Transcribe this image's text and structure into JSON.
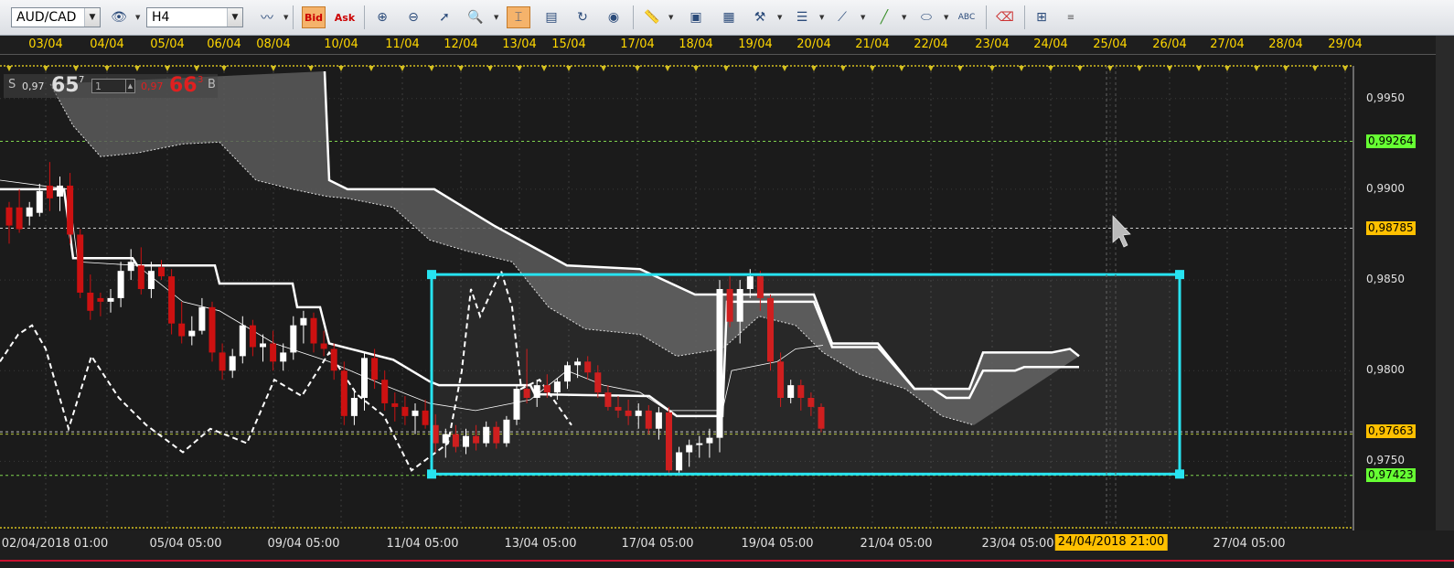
{
  "toolbar": {
    "symbol": "AUD/CAD",
    "timeframe": "H4",
    "bid_label": "Bid",
    "ask_label": "Ask",
    "icons": [
      "eye-settings-icon",
      "indicator-icon",
      "chart-type-icon",
      "crosshair-icon",
      "zoom-in-icon",
      "zoom-out-icon",
      "cursor-icon",
      "zoom-icon",
      "grid-icon",
      "save-icon",
      "refresh-icon",
      "globe-icon",
      "ruler-icon",
      "image-icon",
      "template-icon",
      "tools-icon",
      "lines-icon",
      "fibonacci-icon",
      "pencil-icon",
      "ellipse-icon",
      "text-icon",
      "eraser-icon",
      "network-icon",
      "menu-icon"
    ]
  },
  "quote": {
    "sell_label": "S",
    "sell_prefix": "0,97",
    "sell_big": "65",
    "sell_sup": "7",
    "lot": "1",
    "buy_prefix": "0,97",
    "buy_big": "66",
    "buy_sup": "3",
    "buy_label": "B"
  },
  "date_axis": [
    "03/04",
    "04/04",
    "05/04",
    "06/04",
    "08/04",
    "10/04",
    "11/04",
    "12/04",
    "13/04",
    "15/04",
    "17/04",
    "18/04",
    "19/04",
    "20/04",
    "21/04",
    "22/04",
    "23/04",
    "24/04",
    "25/04",
    "26/04",
    "27/04",
    "28/04",
    "29/04"
  ],
  "price_axis": {
    "labels": [
      "0,9950",
      "0,9900",
      "0,9850",
      "0,9800",
      "0,9750"
    ],
    "markers": [
      {
        "value": "0,99264",
        "color": "#66ff33"
      },
      {
        "value": "0,98785",
        "color": "#ffc000"
      },
      {
        "value": "0,97663",
        "color": "#ffc000"
      },
      {
        "value": "0,97423",
        "color": "#66ff33"
      }
    ]
  },
  "time_axis": [
    "02/04/2018 01:00",
    "05/04 05:00",
    "09/04 05:00",
    "11/04 05:00",
    "13/04 05:00",
    "17/04 05:00",
    "19/04 05:00",
    "21/04 05:00",
    "23/04 05:00",
    "27/04 05:00"
  ],
  "cursor_time": "24/04/2018 21:00",
  "colors": {
    "bull": "#ffffff",
    "bear": "#cc1111",
    "rect": "#27e3f0",
    "cloud": "#5a5a5a"
  },
  "chart_data": {
    "type": "candlestick",
    "symbol": "AUD/CAD",
    "timeframe": "H4",
    "ylim": [
      0.9725,
      0.9965
    ],
    "candles": [
      {
        "o": 0.989,
        "h": 0.9893,
        "l": 0.987,
        "c": 0.988
      },
      {
        "o": 0.989,
        "h": 0.99,
        "l": 0.9876,
        "c": 0.9878
      },
      {
        "o": 0.9885,
        "h": 0.9893,
        "l": 0.988,
        "c": 0.989
      },
      {
        "o": 0.9887,
        "h": 0.9903,
        "l": 0.9885,
        "c": 0.9899
      },
      {
        "o": 0.9902,
        "h": 0.9915,
        "l": 0.9888,
        "c": 0.9895
      },
      {
        "o": 0.9896,
        "h": 0.9907,
        "l": 0.9888,
        "c": 0.9902
      },
      {
        "o": 0.9902,
        "h": 0.9909,
        "l": 0.987,
        "c": 0.9875
      },
      {
        "o": 0.9875,
        "h": 0.9878,
        "l": 0.984,
        "c": 0.9843
      },
      {
        "o": 0.9843,
        "h": 0.9853,
        "l": 0.9828,
        "c": 0.9833
      },
      {
        "o": 0.984,
        "h": 0.9843,
        "l": 0.983,
        "c": 0.9838
      },
      {
        "o": 0.9838,
        "h": 0.9845,
        "l": 0.9832,
        "c": 0.984
      },
      {
        "o": 0.984,
        "h": 0.986,
        "l": 0.9835,
        "c": 0.9855
      },
      {
        "o": 0.9855,
        "h": 0.9867,
        "l": 0.985,
        "c": 0.986
      },
      {
        "o": 0.9858,
        "h": 0.9868,
        "l": 0.9842,
        "c": 0.9845
      },
      {
        "o": 0.9845,
        "h": 0.986,
        "l": 0.984,
        "c": 0.9855
      },
      {
        "o": 0.9857,
        "h": 0.9861,
        "l": 0.985,
        "c": 0.9852
      },
      {
        "o": 0.9852,
        "h": 0.9856,
        "l": 0.982,
        "c": 0.9826
      },
      {
        "o": 0.9826,
        "h": 0.9838,
        "l": 0.9815,
        "c": 0.9819
      },
      {
        "o": 0.9819,
        "h": 0.983,
        "l": 0.9814,
        "c": 0.9822
      },
      {
        "o": 0.9822,
        "h": 0.984,
        "l": 0.982,
        "c": 0.9835
      },
      {
        "o": 0.9835,
        "h": 0.9838,
        "l": 0.9805,
        "c": 0.981
      },
      {
        "o": 0.981,
        "h": 0.9815,
        "l": 0.9795,
        "c": 0.98
      },
      {
        "o": 0.98,
        "h": 0.9812,
        "l": 0.9796,
        "c": 0.9808
      },
      {
        "o": 0.9808,
        "h": 0.983,
        "l": 0.9804,
        "c": 0.9825
      },
      {
        "o": 0.9825,
        "h": 0.9828,
        "l": 0.9808,
        "c": 0.9813
      },
      {
        "o": 0.9813,
        "h": 0.982,
        "l": 0.9805,
        "c": 0.9815
      },
      {
        "o": 0.9815,
        "h": 0.9822,
        "l": 0.98,
        "c": 0.9805
      },
      {
        "o": 0.9805,
        "h": 0.9815,
        "l": 0.98,
        "c": 0.981
      },
      {
        "o": 0.981,
        "h": 0.983,
        "l": 0.9806,
        "c": 0.9825
      },
      {
        "o": 0.9825,
        "h": 0.9833,
        "l": 0.9815,
        "c": 0.9829
      },
      {
        "o": 0.9829,
        "h": 0.9832,
        "l": 0.981,
        "c": 0.9815
      },
      {
        "o": 0.9815,
        "h": 0.9822,
        "l": 0.9808,
        "c": 0.9812
      },
      {
        "o": 0.9812,
        "h": 0.9815,
        "l": 0.9795,
        "c": 0.98
      },
      {
        "o": 0.98,
        "h": 0.9805,
        "l": 0.977,
        "c": 0.9775
      },
      {
        "o": 0.9775,
        "h": 0.979,
        "l": 0.977,
        "c": 0.9785
      },
      {
        "o": 0.9785,
        "h": 0.981,
        "l": 0.9778,
        "c": 0.9807
      },
      {
        "o": 0.9807,
        "h": 0.9812,
        "l": 0.979,
        "c": 0.9795
      },
      {
        "o": 0.9795,
        "h": 0.98,
        "l": 0.9778,
        "c": 0.9782
      },
      {
        "o": 0.9782,
        "h": 0.9788,
        "l": 0.9772,
        "c": 0.978
      },
      {
        "o": 0.978,
        "h": 0.9786,
        "l": 0.977,
        "c": 0.9775
      },
      {
        "o": 0.9775,
        "h": 0.9782,
        "l": 0.9765,
        "c": 0.9778
      },
      {
        "o": 0.9778,
        "h": 0.9784,
        "l": 0.9768,
        "c": 0.977
      },
      {
        "o": 0.977,
        "h": 0.9776,
        "l": 0.9755,
        "c": 0.976
      },
      {
        "o": 0.976,
        "h": 0.9768,
        "l": 0.9752,
        "c": 0.9765
      },
      {
        "o": 0.9765,
        "h": 0.977,
        "l": 0.9755,
        "c": 0.9758
      },
      {
        "o": 0.9758,
        "h": 0.9768,
        "l": 0.9754,
        "c": 0.9764
      },
      {
        "o": 0.9764,
        "h": 0.977,
        "l": 0.9756,
        "c": 0.976
      },
      {
        "o": 0.976,
        "h": 0.9772,
        "l": 0.9758,
        "c": 0.9769
      },
      {
        "o": 0.9769,
        "h": 0.9772,
        "l": 0.9757,
        "c": 0.976
      },
      {
        "o": 0.976,
        "h": 0.9775,
        "l": 0.9758,
        "c": 0.9773
      },
      {
        "o": 0.9773,
        "h": 0.9792,
        "l": 0.977,
        "c": 0.979
      },
      {
        "o": 0.979,
        "h": 0.9812,
        "l": 0.9782,
        "c": 0.9785
      },
      {
        "o": 0.9785,
        "h": 0.9795,
        "l": 0.978,
        "c": 0.9792
      },
      {
        "o": 0.9792,
        "h": 0.9798,
        "l": 0.9785,
        "c": 0.9788
      },
      {
        "o": 0.9788,
        "h": 0.9796,
        "l": 0.9784,
        "c": 0.9794
      },
      {
        "o": 0.9794,
        "h": 0.9805,
        "l": 0.979,
        "c": 0.9803
      },
      {
        "o": 0.9803,
        "h": 0.9807,
        "l": 0.9796,
        "c": 0.9805
      },
      {
        "o": 0.9805,
        "h": 0.9808,
        "l": 0.9795,
        "c": 0.9799
      },
      {
        "o": 0.9799,
        "h": 0.9803,
        "l": 0.9785,
        "c": 0.9788
      },
      {
        "o": 0.9788,
        "h": 0.9792,
        "l": 0.9778,
        "c": 0.978
      },
      {
        "o": 0.978,
        "h": 0.9786,
        "l": 0.9774,
        "c": 0.9778
      },
      {
        "o": 0.9778,
        "h": 0.9784,
        "l": 0.977,
        "c": 0.9775
      },
      {
        "o": 0.9775,
        "h": 0.9782,
        "l": 0.9768,
        "c": 0.9778
      },
      {
        "o": 0.9778,
        "h": 0.9781,
        "l": 0.9765,
        "c": 0.9768
      },
      {
        "o": 0.9768,
        "h": 0.978,
        "l": 0.9762,
        "c": 0.9777
      },
      {
        "o": 0.9777,
        "h": 0.978,
        "l": 0.9742,
        "c": 0.9745
      },
      {
        "o": 0.9745,
        "h": 0.9758,
        "l": 0.9742,
        "c": 0.9755
      },
      {
        "o": 0.9755,
        "h": 0.9762,
        "l": 0.9747,
        "c": 0.9759
      },
      {
        "o": 0.9759,
        "h": 0.9764,
        "l": 0.9752,
        "c": 0.976
      },
      {
        "o": 0.976,
        "h": 0.9768,
        "l": 0.9752,
        "c": 0.9763
      },
      {
        "o": 0.9763,
        "h": 0.985,
        "l": 0.9755,
        "c": 0.9845
      },
      {
        "o": 0.9845,
        "h": 0.9852,
        "l": 0.9824,
        "c": 0.9827
      },
      {
        "o": 0.9827,
        "h": 0.985,
        "l": 0.9815,
        "c": 0.9845
      },
      {
        "o": 0.9845,
        "h": 0.9856,
        "l": 0.984,
        "c": 0.9852
      },
      {
        "o": 0.9852,
        "h": 0.9855,
        "l": 0.9833,
        "c": 0.984
      },
      {
        "o": 0.984,
        "h": 0.9842,
        "l": 0.98,
        "c": 0.9805
      },
      {
        "o": 0.9805,
        "h": 0.981,
        "l": 0.978,
        "c": 0.9785
      },
      {
        "o": 0.9785,
        "h": 0.9795,
        "l": 0.9782,
        "c": 0.9792
      },
      {
        "o": 0.9792,
        "h": 0.9795,
        "l": 0.9778,
        "c": 0.9785
      },
      {
        "o": 0.9785,
        "h": 0.9788,
        "l": 0.9775,
        "c": 0.978
      },
      {
        "o": 0.978,
        "h": 0.9782,
        "l": 0.9766,
        "c": 0.9768
      }
    ],
    "ichimoku_kijun": [
      [
        0,
        0.99
      ],
      [
        70,
        0.99
      ],
      [
        80,
        0.9862
      ],
      [
        145,
        0.9862
      ],
      [
        150,
        0.9858
      ],
      [
        235,
        0.9858
      ],
      [
        240,
        0.9848
      ],
      [
        320,
        0.9848
      ],
      [
        325,
        0.9835
      ],
      [
        350,
        0.9835
      ],
      [
        360,
        0.9815
      ],
      [
        430,
        0.9806
      ],
      [
        470,
        0.9794
      ],
      [
        480,
        0.9792
      ],
      [
        580,
        0.9792
      ],
      [
        585,
        0.9787
      ],
      [
        710,
        0.9786
      ],
      [
        740,
        0.9775
      ],
      [
        790,
        0.9775
      ],
      [
        795,
        0.9838
      ],
      [
        890,
        0.9838
      ],
      [
        910,
        0.9813
      ],
      [
        960,
        0.9813
      ],
      [
        1000,
        0.979
      ],
      [
        1020,
        0.979
      ],
      [
        1035,
        0.9785
      ],
      [
        1060,
        0.9785
      ],
      [
        1075,
        0.98
      ],
      [
        1110,
        0.98
      ],
      [
        1120,
        0.9802
      ],
      [
        1180,
        0.9802
      ]
    ],
    "ichimoku_tenkan": [
      [
        0,
        0.9905
      ],
      [
        75,
        0.99
      ],
      [
        85,
        0.986
      ],
      [
        150,
        0.9858
      ],
      [
        200,
        0.9838
      ],
      [
        240,
        0.9833
      ],
      [
        300,
        0.9815
      ],
      [
        360,
        0.9805
      ],
      [
        420,
        0.9792
      ],
      [
        470,
        0.9782
      ],
      [
        520,
        0.9778
      ],
      [
        580,
        0.9784
      ],
      [
        620,
        0.98
      ],
      [
        660,
        0.9792
      ],
      [
        700,
        0.9788
      ],
      [
        730,
        0.9778
      ],
      [
        790,
        0.9778
      ],
      [
        800,
        0.98
      ],
      [
        850,
        0.9805
      ],
      [
        870,
        0.9812
      ],
      [
        900,
        0.9814
      ]
    ],
    "chikou_span": [
      [
        0,
        0.9805
      ],
      [
        20,
        0.982
      ],
      [
        35,
        0.9825
      ],
      [
        50,
        0.9812
      ],
      [
        75,
        0.9768
      ],
      [
        100,
        0.9808
      ],
      [
        130,
        0.9785
      ],
      [
        160,
        0.977
      ],
      [
        200,
        0.9755
      ],
      [
        230,
        0.9768
      ],
      [
        270,
        0.976
      ],
      [
        300,
        0.9795
      ],
      [
        330,
        0.9786
      ],
      [
        360,
        0.981
      ],
      [
        390,
        0.9787
      ],
      [
        420,
        0.9775
      ],
      [
        450,
        0.9745
      ],
      [
        490,
        0.976
      ],
      [
        505,
        0.98
      ],
      [
        515,
        0.9845
      ],
      [
        525,
        0.983
      ],
      [
        548,
        0.9855
      ],
      [
        560,
        0.9835
      ],
      [
        570,
        0.979
      ],
      [
        590,
        0.9795
      ],
      [
        625,
        0.977
      ]
    ],
    "senkou_a": [
      [
        55,
        0.9958
      ],
      [
        80,
        0.9935
      ],
      [
        110,
        0.9918
      ],
      [
        150,
        0.992
      ],
      [
        200,
        0.9925
      ],
      [
        240,
        0.9926
      ],
      [
        280,
        0.9905
      ],
      [
        320,
        0.99
      ],
      [
        358,
        0.9896
      ],
      [
        380,
        0.9895
      ],
      [
        430,
        0.989
      ],
      [
        470,
        0.9872
      ],
      [
        510,
        0.9866
      ],
      [
        560,
        0.986
      ],
      [
        600,
        0.9835
      ],
      [
        640,
        0.9823
      ],
      [
        700,
        0.982
      ],
      [
        740,
        0.9808
      ],
      [
        790,
        0.9812
      ],
      [
        830,
        0.983
      ],
      [
        870,
        0.9825
      ],
      [
        900,
        0.981
      ],
      [
        940,
        0.9798
      ],
      [
        990,
        0.979
      ],
      [
        1030,
        0.9775
      ],
      [
        1065,
        0.977
      ]
    ],
    "senkou_b": [
      [
        355,
        0.9965
      ],
      [
        360,
        0.9905
      ],
      [
        380,
        0.99
      ],
      [
        475,
        0.99
      ],
      [
        540,
        0.988
      ],
      [
        620,
        0.9858
      ],
      [
        700,
        0.9856
      ],
      [
        760,
        0.9842
      ],
      [
        890,
        0.9842
      ],
      [
        910,
        0.9815
      ],
      [
        960,
        0.9815
      ],
      [
        1000,
        0.979
      ],
      [
        1060,
        0.979
      ],
      [
        1075,
        0.981
      ],
      [
        1150,
        0.981
      ],
      [
        1170,
        0.9812
      ],
      [
        1180,
        0.9808
      ]
    ],
    "rectangle": {
      "t0": 472,
      "t1": 1290,
      "p0": 0.9853,
      "p1": 0.9743
    },
    "hlines": [
      0.99264,
      0.98785,
      0.97663,
      0.9765,
      0.97423
    ]
  }
}
